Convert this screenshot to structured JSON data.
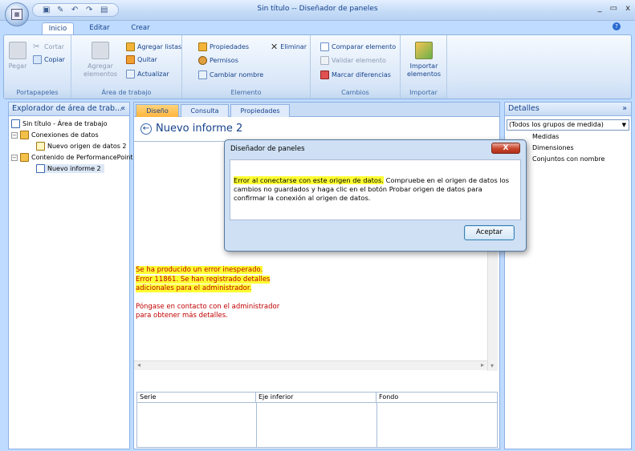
{
  "window": {
    "title": "Sin título -- Diseñador de paneles",
    "min": "_",
    "max": "▭",
    "close": "x"
  },
  "tabs": [
    {
      "label": "Inicio"
    },
    {
      "label": "Editar"
    },
    {
      "label": "Crear"
    }
  ],
  "ribbon": {
    "groups": {
      "clipboard": "Portapapeles",
      "workspace": "Área de trabajo",
      "element": "Elemento",
      "changes": "Cambios",
      "import": "Importar"
    },
    "pegar": "Pegar",
    "cortar": "Cortar",
    "copiar": "Copiar",
    "agregar_elementos": "Agregar elementos",
    "agregar_listas": "Agregar listas",
    "quitar": "Quitar",
    "actualizar": "Actualizar",
    "propiedades": "Propiedades",
    "eliminar": "Eliminar",
    "permisos": "Permisos",
    "cambiar_nombre": "Cambiar nombre",
    "comparar_elemento": "Comparar elemento",
    "validar_elemento": "Validar elemento",
    "marcar_diferencias": "Marcar diferencias",
    "importar_elementos": "Importar elementos"
  },
  "left_panel": {
    "title": "Explorador de área de trab...",
    "collapse": "«",
    "tree": [
      "Sin título - Área de trabajo",
      "Conexiones de datos",
      "Nuevo origen de datos 2",
      "Contenido de PerformancePoint",
      "Nuevo informe 2"
    ]
  },
  "center": {
    "tabs": [
      "Diseño",
      "Consulta",
      "Propiedades"
    ],
    "report_title": "Nuevo informe 2",
    "error_line1": "Se ha producido un error inesperado.",
    "error_line2": "Error 11861. Se han registrado detalles",
    "error_line3": "adicionales para el administrador.",
    "contact_line1": "Póngase en contacto con el administrador",
    "contact_line2": "para obtener más detalles.",
    "grid_headers": [
      "Serie",
      "Eje inferior",
      "Fondo"
    ]
  },
  "right_panel": {
    "title": "Detalles",
    "collapse": "»",
    "dropdown_value": "(Todos los grupos de medida)",
    "items": [
      "Medidas",
      "Dimensiones",
      "Conjuntos con nombre"
    ]
  },
  "dialog": {
    "title": "Diseñador de paneles",
    "close": "X",
    "message_highlight": "Error al conectarse con este origen de datos.",
    "message_rest": " Compruebe en el origen de datos los cambios no guardados y haga clic en el botón Probar origen de datos para confirmar la conexión al origen de datos.",
    "ok": "Aceptar"
  }
}
